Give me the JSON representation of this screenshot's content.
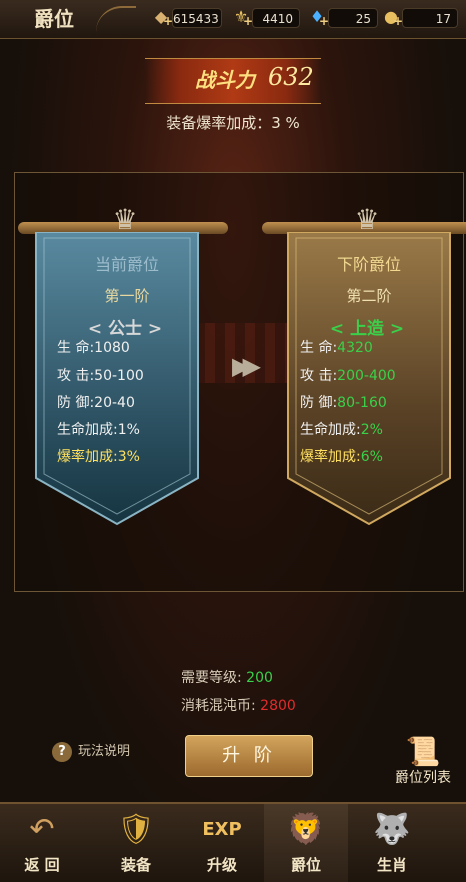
{
  "header": {
    "title": "爵位",
    "resources": [
      {
        "icon": "ingot-icon",
        "value": "615433"
      },
      {
        "icon": "gold-icon",
        "value": "4410"
      },
      {
        "icon": "diamond-icon",
        "value": "25"
      },
      {
        "icon": "coin-icon",
        "value": "17"
      }
    ]
  },
  "power": {
    "label": "战斗力",
    "value": "632"
  },
  "drop_bonus": "装备爆率加成：3 %",
  "current": {
    "header": "当前爵位",
    "tier": "第一阶",
    "rank": "< 公士 >",
    "stats": [
      {
        "k": "生 命:",
        "v": "1080"
      },
      {
        "k": "攻 击:",
        "v": "50-100"
      },
      {
        "k": "防 御:",
        "v": "20-40"
      },
      {
        "k": "生命加成:",
        "v": "1%"
      },
      {
        "k": "爆率加成:",
        "v": "3%"
      }
    ]
  },
  "next": {
    "header": "下阶爵位",
    "tier": "第二阶",
    "rank": "< 上造 >",
    "stats": [
      {
        "k": "生 命:",
        "v": "4320"
      },
      {
        "k": "攻 击:",
        "v": "200-400"
      },
      {
        "k": "防 御:",
        "v": "80-160"
      },
      {
        "k": "生命加成:",
        "v": "2%"
      },
      {
        "k": "爆率加成:",
        "v": "6%"
      }
    ]
  },
  "requirements": {
    "level_label": "需要等级:",
    "level_value": "200",
    "cost_label": "消耗混沌币:",
    "cost_value": "2800"
  },
  "buttons": {
    "rules": "玩法说明",
    "upgrade": "升 阶",
    "list": "爵位列表"
  },
  "nav": [
    {
      "label": "返 回",
      "icon": "back-arrow-icon"
    },
    {
      "label": "装备",
      "icon": "armor-icon"
    },
    {
      "label": "升级",
      "icon": "exp-icon"
    },
    {
      "label": "爵位",
      "icon": "rank-icon"
    },
    {
      "label": "生肖",
      "icon": "zodiac-icon"
    }
  ],
  "colors": {
    "gold_text": "#ffe080",
    "green_value": "#3ad04a",
    "red_value": "#e02c2c",
    "highlight_yellow": "#ffe060",
    "blue_banner": "#3f6f84",
    "gold_banner": "#8a6a3c"
  }
}
